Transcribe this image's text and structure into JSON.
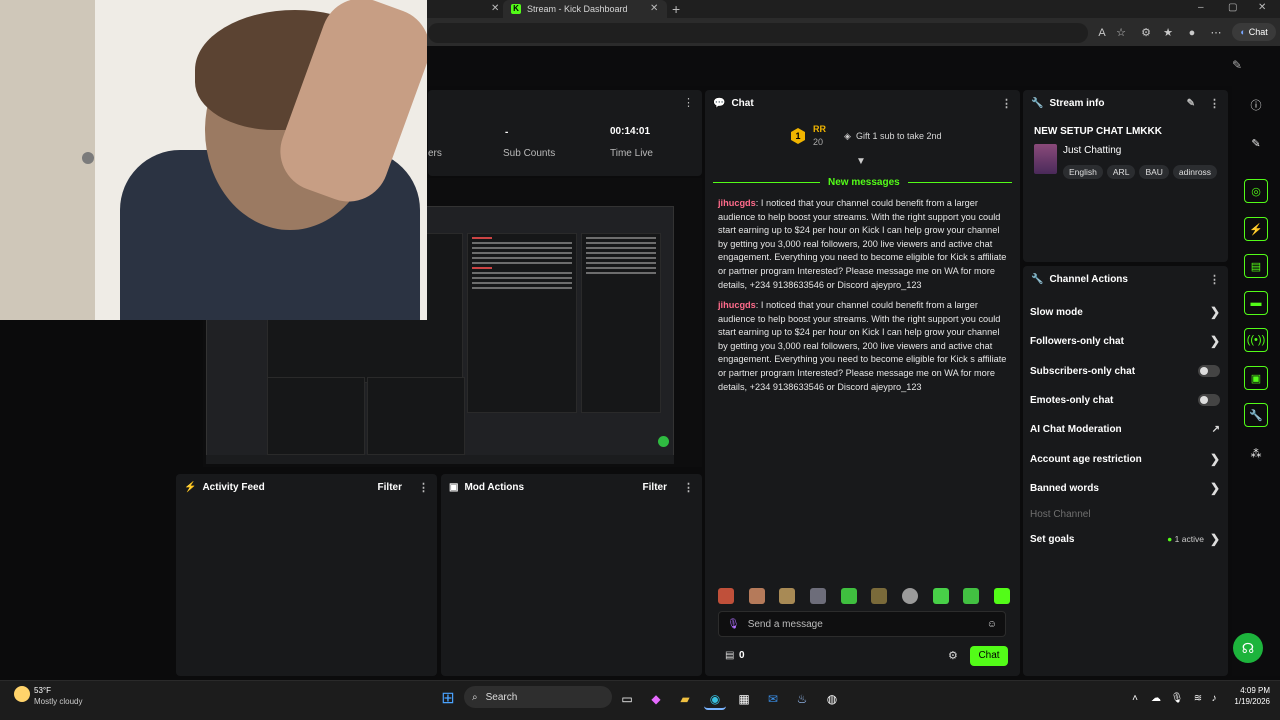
{
  "browser": {
    "active_tab_title": "Stream - Kick Dashboard",
    "copilot_label": "Chat"
  },
  "stats": {
    "col1_label": "ers",
    "sub_counts_value": "-",
    "sub_counts_label": "Sub Counts",
    "time_live_value": "00:14:01",
    "time_live_label": "Time Live"
  },
  "activity_feed": {
    "title": "Activity Feed",
    "filter_label": "Filter"
  },
  "mod_actions": {
    "title": "Mod Actions",
    "filter_label": "Filter"
  },
  "chat": {
    "title": "Chat",
    "pinned_user_initials": "RR",
    "pinned_rank": "1",
    "pinned_count": "20",
    "gift_text": "Gift 1 sub to take 2nd",
    "new_messages_label": "New messages",
    "messages": [
      {
        "user": "jihucgds",
        "text": ": I noticed that your channel could benefit from a larger audience to help boost your streams. With the right support you could start earning up to $24 per hour on Kick I can help grow your channel by getting you 3,000 real followers, 200 live viewers and active chat engagement. Everything you need to become eligible for Kick s affiliate or partner program Interested? Please message me on WA for more details, +234 9138633546 or Discord ajeypro_123"
      },
      {
        "user": "jihucgds",
        "text": ": I noticed that your channel could benefit from a larger audience to help boost your streams. With the right support you could start earning up to $24 per hour on Kick I can help grow your channel by getting you 3,000 real followers, 200 live viewers and active chat engagement. Everything you need to become eligible for Kick s affiliate or partner program Interested? Please message me on WA for more details, +234 9138633546 or Discord ajeypro_123"
      }
    ],
    "input_placeholder": "Send a message",
    "points_value": "0",
    "send_label": "Chat"
  },
  "stream_info": {
    "title": "Stream info",
    "stream_title": "NEW SETUP CHAT LMKKK",
    "category": "Just Chatting",
    "tags": [
      "English",
      "ARL",
      "BAU",
      "adinross"
    ]
  },
  "channel_actions": {
    "title": "Channel Actions",
    "items": [
      {
        "label": "Slow mode",
        "control": "chevron"
      },
      {
        "label": "Followers-only chat",
        "control": "chevron"
      },
      {
        "label": "Subscribers-only chat",
        "control": "toggle"
      },
      {
        "label": "Emotes-only chat",
        "control": "toggle"
      },
      {
        "label": "AI Chat Moderation",
        "control": "external"
      },
      {
        "label": "Account age restriction",
        "control": "chevron"
      },
      {
        "label": "Banned words",
        "control": "chevron"
      },
      {
        "label": "Host Channel",
        "control": "none"
      },
      {
        "label": "Set goals",
        "control": "chevron",
        "status": "1 active"
      }
    ]
  },
  "taskbar": {
    "weather_temp": "53°F",
    "weather_desc": "Mostly cloudy",
    "search_label": "Search",
    "time": "4:09 PM",
    "date": "1/19/2026"
  },
  "colors": {
    "kick_green": "#53fc18",
    "username": "#ff6b8b",
    "panel": "#18191b"
  }
}
